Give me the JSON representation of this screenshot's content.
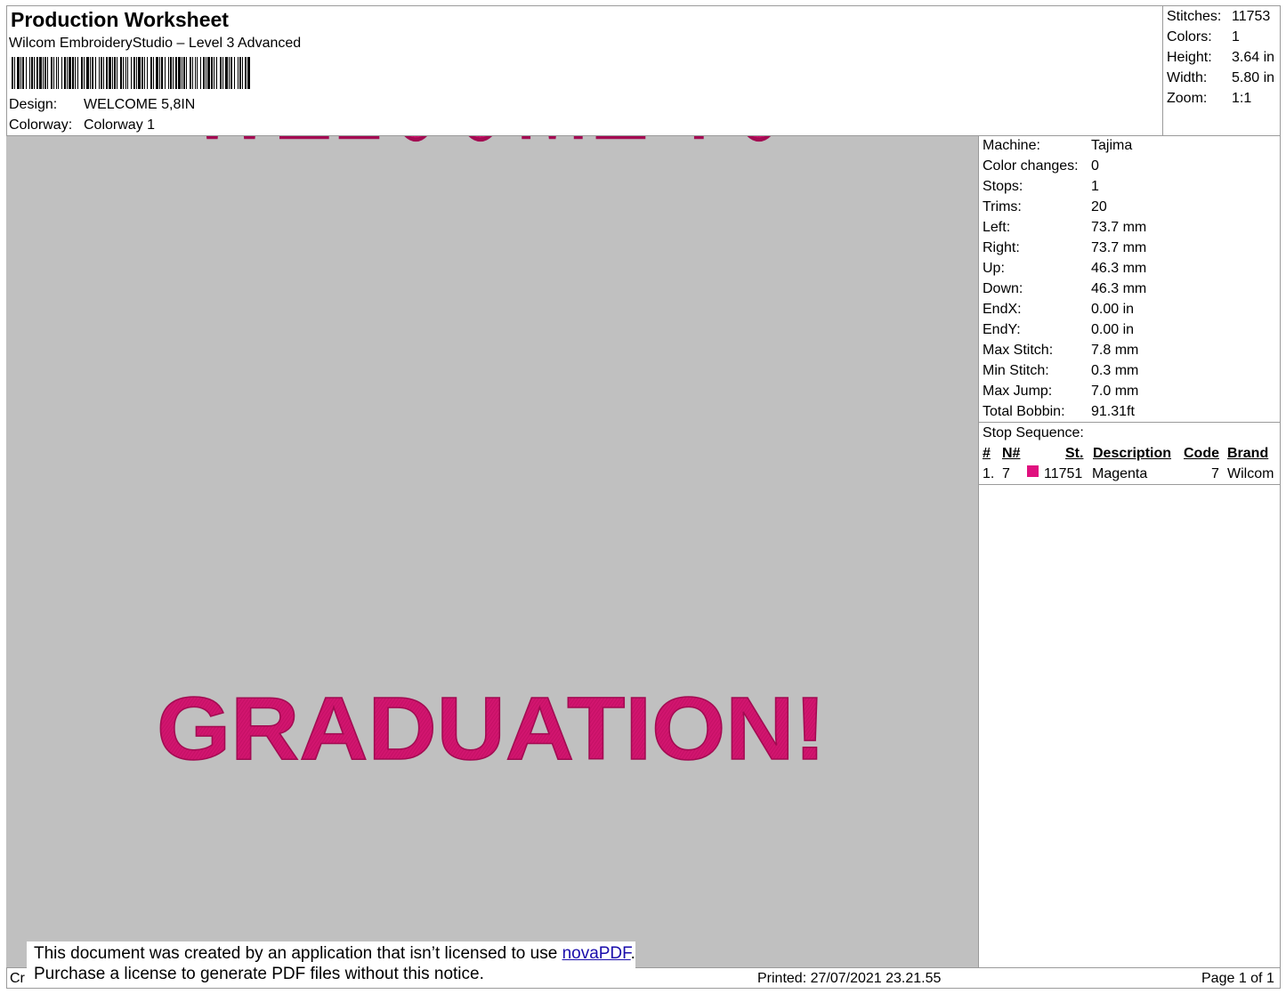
{
  "header": {
    "title": "Production Worksheet",
    "subtitle": "Wilcom EmbroideryStudio – Level 3 Advanced",
    "design_label": "Design:",
    "design_value": "WELCOME 5,8IN",
    "colorway_label": "Colorway:",
    "colorway_value": "Colorway 1"
  },
  "stats": [
    {
      "label": "Stitches:",
      "value": "11753"
    },
    {
      "label": "Colors:",
      "value": "1"
    },
    {
      "label": "Height:",
      "value": "3.64 in"
    },
    {
      "label": "Width:",
      "value": "5.80 in"
    },
    {
      "label": "Zoom:",
      "value": "1:1"
    }
  ],
  "machine": [
    {
      "label": "Machine:",
      "value": "Tajima"
    },
    {
      "label": "Color changes:",
      "value": "0"
    },
    {
      "label": "Stops:",
      "value": "1"
    },
    {
      "label": "Trims:",
      "value": "20"
    },
    {
      "label": "Left:",
      "value": "73.7 mm"
    },
    {
      "label": "Right:",
      "value": "73.7 mm"
    },
    {
      "label": "Up:",
      "value": "46.3 mm"
    },
    {
      "label": "Down:",
      "value": "46.3 mm"
    },
    {
      "label": "EndX:",
      "value": "0.00 in"
    },
    {
      "label": "EndY:",
      "value": "0.00 in"
    },
    {
      "label": "Max Stitch:",
      "value": "7.8 mm"
    },
    {
      "label": "Min Stitch:",
      "value": "0.3 mm"
    },
    {
      "label": "Max Jump:",
      "value": "7.0 mm"
    },
    {
      "label": "Total Bobbin:",
      "value": "91.31ft"
    }
  ],
  "stop_sequence": {
    "title": "Stop Sequence:",
    "headers": [
      "#",
      "N#",
      "St.",
      "Description",
      "Code",
      "Brand"
    ],
    "rows": [
      {
        "index": "1.",
        "needle": "7",
        "color": "#e0117f",
        "stitches": "11751",
        "description": "Magenta",
        "code": "7",
        "brand": "Wilcom"
      }
    ]
  },
  "design_text": {
    "line1": "WELCOME TO",
    "line2": "GRADUATION!",
    "thread_color": "#d2156f",
    "background": "#c0c0c0"
  },
  "footer": {
    "left_partial": "Cr",
    "notice_line1_before": "This document was created by an application that isn’t licensed to use ",
    "notice_link": "novaPDF",
    "notice_line1_after": ".",
    "notice_line2": "Purchase a license to generate PDF files without this notice.",
    "printed": "Printed: 27/07/2021 23.21.55",
    "page": "Page 1 of 1"
  }
}
